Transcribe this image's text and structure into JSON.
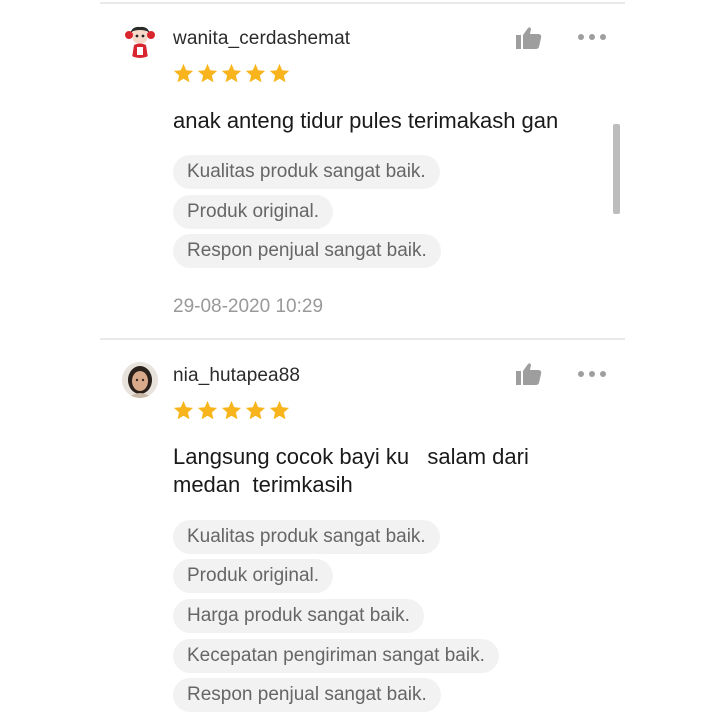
{
  "colors": {
    "star": "#f8b41c",
    "tag_bg": "#f2f2f2",
    "tag_text": "#666666",
    "timestamp": "#999999",
    "divider": "#e9e9e9"
  },
  "reviews": [
    {
      "username": "wanita_cerdashemat",
      "avatar_icon": "red-doll-avatar-icon",
      "rating": 5,
      "comment": "anak anteng tidur pules terimakash gan",
      "tags": [
        "Kualitas produk sangat baik.",
        "Produk original.",
        "Respon penjual sangat baik."
      ],
      "timestamp": "29-08-2020 10:29"
    },
    {
      "username": "nia_hutapea88",
      "avatar_icon": "photo-avatar-icon",
      "rating": 5,
      "comment": "Langsung cocok bayi ku   salam dari medan  terimkasih",
      "tags": [
        "Kualitas produk sangat baik.",
        "Produk original.",
        "Harga produk sangat baik.",
        "Kecepatan pengiriman sangat baik.",
        "Respon penjual sangat baik."
      ]
    }
  ],
  "icons": {
    "like": "thumbs-up-icon",
    "more": "more-options-icon",
    "star": "star-icon"
  }
}
